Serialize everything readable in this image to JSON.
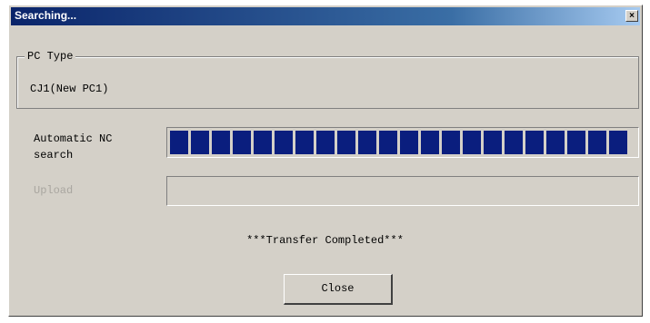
{
  "window": {
    "title": "Searching...",
    "close_glyph": "×"
  },
  "pc_type": {
    "group_label": "PC Type",
    "value": "CJ1(New PC1)"
  },
  "automatic_nc_search": {
    "label_line1": "Automatic NC",
    "label_line2": "search",
    "progress": 1.0,
    "block_count": 22,
    "block_color": "#0a1e7e"
  },
  "upload": {
    "label": "Upload",
    "progress": 0
  },
  "status_text": "***Transfer Completed***",
  "close_button_label": "Close"
}
